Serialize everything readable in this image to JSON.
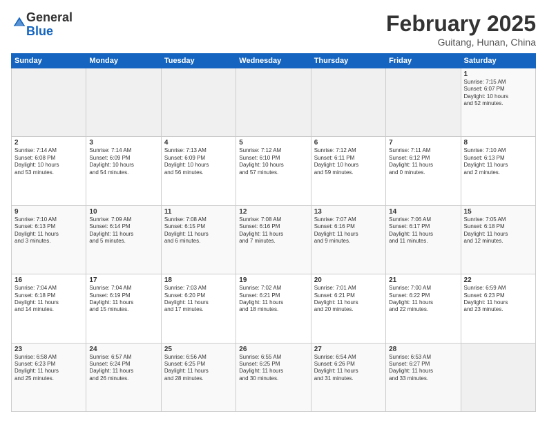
{
  "logo": {
    "general": "General",
    "blue": "Blue"
  },
  "header": {
    "month": "February 2025",
    "location": "Guitang, Hunan, China"
  },
  "weekdays": [
    "Sunday",
    "Monday",
    "Tuesday",
    "Wednesday",
    "Thursday",
    "Friday",
    "Saturday"
  ],
  "weeks": [
    [
      {
        "day": "",
        "info": ""
      },
      {
        "day": "",
        "info": ""
      },
      {
        "day": "",
        "info": ""
      },
      {
        "day": "",
        "info": ""
      },
      {
        "day": "",
        "info": ""
      },
      {
        "day": "",
        "info": ""
      },
      {
        "day": "1",
        "info": "Sunrise: 7:15 AM\nSunset: 6:07 PM\nDaylight: 10 hours\nand 52 minutes."
      }
    ],
    [
      {
        "day": "2",
        "info": "Sunrise: 7:14 AM\nSunset: 6:08 PM\nDaylight: 10 hours\nand 53 minutes."
      },
      {
        "day": "3",
        "info": "Sunrise: 7:14 AM\nSunset: 6:09 PM\nDaylight: 10 hours\nand 54 minutes."
      },
      {
        "day": "4",
        "info": "Sunrise: 7:13 AM\nSunset: 6:09 PM\nDaylight: 10 hours\nand 56 minutes."
      },
      {
        "day": "5",
        "info": "Sunrise: 7:12 AM\nSunset: 6:10 PM\nDaylight: 10 hours\nand 57 minutes."
      },
      {
        "day": "6",
        "info": "Sunrise: 7:12 AM\nSunset: 6:11 PM\nDaylight: 10 hours\nand 59 minutes."
      },
      {
        "day": "7",
        "info": "Sunrise: 7:11 AM\nSunset: 6:12 PM\nDaylight: 11 hours\nand 0 minutes."
      },
      {
        "day": "8",
        "info": "Sunrise: 7:10 AM\nSunset: 6:13 PM\nDaylight: 11 hours\nand 2 minutes."
      }
    ],
    [
      {
        "day": "9",
        "info": "Sunrise: 7:10 AM\nSunset: 6:13 PM\nDaylight: 11 hours\nand 3 minutes."
      },
      {
        "day": "10",
        "info": "Sunrise: 7:09 AM\nSunset: 6:14 PM\nDaylight: 11 hours\nand 5 minutes."
      },
      {
        "day": "11",
        "info": "Sunrise: 7:08 AM\nSunset: 6:15 PM\nDaylight: 11 hours\nand 6 minutes."
      },
      {
        "day": "12",
        "info": "Sunrise: 7:08 AM\nSunset: 6:16 PM\nDaylight: 11 hours\nand 7 minutes."
      },
      {
        "day": "13",
        "info": "Sunrise: 7:07 AM\nSunset: 6:16 PM\nDaylight: 11 hours\nand 9 minutes."
      },
      {
        "day": "14",
        "info": "Sunrise: 7:06 AM\nSunset: 6:17 PM\nDaylight: 11 hours\nand 11 minutes."
      },
      {
        "day": "15",
        "info": "Sunrise: 7:05 AM\nSunset: 6:18 PM\nDaylight: 11 hours\nand 12 minutes."
      }
    ],
    [
      {
        "day": "16",
        "info": "Sunrise: 7:04 AM\nSunset: 6:18 PM\nDaylight: 11 hours\nand 14 minutes."
      },
      {
        "day": "17",
        "info": "Sunrise: 7:04 AM\nSunset: 6:19 PM\nDaylight: 11 hours\nand 15 minutes."
      },
      {
        "day": "18",
        "info": "Sunrise: 7:03 AM\nSunset: 6:20 PM\nDaylight: 11 hours\nand 17 minutes."
      },
      {
        "day": "19",
        "info": "Sunrise: 7:02 AM\nSunset: 6:21 PM\nDaylight: 11 hours\nand 18 minutes."
      },
      {
        "day": "20",
        "info": "Sunrise: 7:01 AM\nSunset: 6:21 PM\nDaylight: 11 hours\nand 20 minutes."
      },
      {
        "day": "21",
        "info": "Sunrise: 7:00 AM\nSunset: 6:22 PM\nDaylight: 11 hours\nand 22 minutes."
      },
      {
        "day": "22",
        "info": "Sunrise: 6:59 AM\nSunset: 6:23 PM\nDaylight: 11 hours\nand 23 minutes."
      }
    ],
    [
      {
        "day": "23",
        "info": "Sunrise: 6:58 AM\nSunset: 6:23 PM\nDaylight: 11 hours\nand 25 minutes."
      },
      {
        "day": "24",
        "info": "Sunrise: 6:57 AM\nSunset: 6:24 PM\nDaylight: 11 hours\nand 26 minutes."
      },
      {
        "day": "25",
        "info": "Sunrise: 6:56 AM\nSunset: 6:25 PM\nDaylight: 11 hours\nand 28 minutes."
      },
      {
        "day": "26",
        "info": "Sunrise: 6:55 AM\nSunset: 6:25 PM\nDaylight: 11 hours\nand 30 minutes."
      },
      {
        "day": "27",
        "info": "Sunrise: 6:54 AM\nSunset: 6:26 PM\nDaylight: 11 hours\nand 31 minutes."
      },
      {
        "day": "28",
        "info": "Sunrise: 6:53 AM\nSunset: 6:27 PM\nDaylight: 11 hours\nand 33 minutes."
      },
      {
        "day": "",
        "info": ""
      }
    ]
  ]
}
